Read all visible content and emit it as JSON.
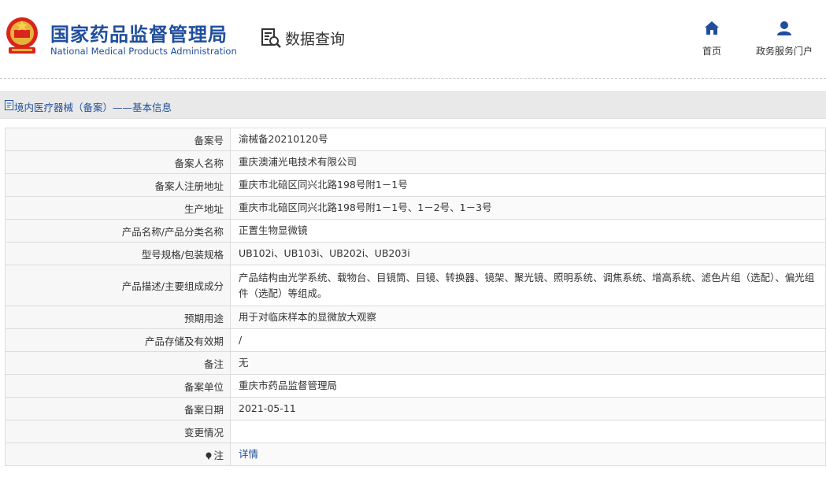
{
  "header": {
    "org_name_cn": "国家药品监督管理局",
    "org_name_en": "National Medical Products Administration",
    "section_title": "数据查询",
    "nav": [
      {
        "label": "首页",
        "icon": "home-icon"
      },
      {
        "label": "政务服务门户",
        "icon": "user-icon"
      }
    ]
  },
  "breadcrumb": {
    "text": "境内医疗器械（备案）——基本信息",
    "icon": "document-icon"
  },
  "colors": {
    "brand_blue": "#1f4e9c",
    "label_bg": "#f7f7f7",
    "border": "#dcdcdc"
  },
  "record": [
    {
      "label": "备案号",
      "value": "渝械备20210120号"
    },
    {
      "label": "备案人名称",
      "value": "重庆澳浦光电技术有限公司"
    },
    {
      "label": "备案人注册地址",
      "value": "重庆市北碚区同兴北路198号附1－1号"
    },
    {
      "label": "生产地址",
      "value": "重庆市北碚区同兴北路198号附1－1号、1－2号、1－3号"
    },
    {
      "label": "产品名称/产品分类名称",
      "value": "正置生物显微镜"
    },
    {
      "label": "型号规格/包装规格",
      "value": "UB102i、UB103i、UB202i、UB203i"
    },
    {
      "label": "产品描述/主要组成成分",
      "value": "产品结构由光学系统、载物台、目镜筒、目镜、转换器、镜架、聚光镜、照明系统、调焦系统、增高系统、滤色片组（选配）、偏光组件（选配）等组成。"
    },
    {
      "label": "预期用途",
      "value": "用于对临床样本的显微放大观察"
    },
    {
      "label": "产品存储及有效期",
      "value": "/"
    },
    {
      "label": "备注",
      "value": "无"
    },
    {
      "label": "备案单位",
      "value": "重庆市药品监督管理局"
    },
    {
      "label": "备案日期",
      "value": "2021-05-11"
    },
    {
      "label": "变更情况",
      "value": ""
    },
    {
      "label": "注",
      "value": "详情",
      "icon": "pin-icon"
    }
  ]
}
